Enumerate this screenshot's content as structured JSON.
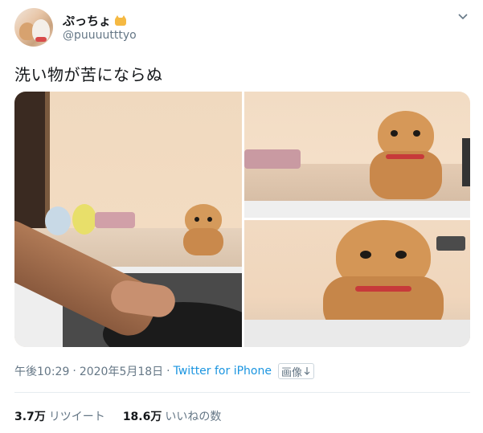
{
  "author": {
    "display_name": "ぷっちょ",
    "name_emoji": "cat-emoji",
    "handle": "@puuuutttyo"
  },
  "tweet": {
    "text": "洗い物が苦にならぬ"
  },
  "media": {
    "photos": [
      {
        "name": "photo-1"
      },
      {
        "name": "photo-2"
      },
      {
        "name": "photo-3"
      }
    ]
  },
  "meta": {
    "time": "午後10:29",
    "separator": "·",
    "date": "2020年5月18日",
    "source": "Twitter for iPhone",
    "media_label": "画像",
    "media_icon": "download-arrow-icon"
  },
  "stats": {
    "retweets_count": "3.7万",
    "retweets_label": "リツイート",
    "likes_count": "18.6万",
    "likes_label": "いいねの数"
  },
  "colors": {
    "link": "#1b95e0",
    "secondary_text": "#657786",
    "primary_text": "#14171a",
    "divider": "#e6ecf0"
  }
}
